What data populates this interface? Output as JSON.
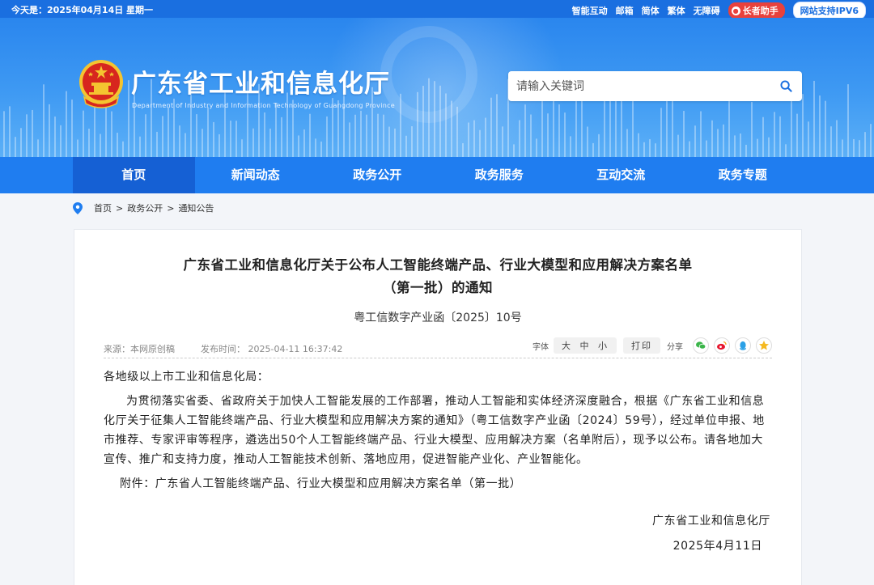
{
  "topbar": {
    "date": "今天是：2025年04月14日 星期一",
    "links": [
      "智能互动",
      "邮箱",
      "简体",
      "繁体",
      "无障碍"
    ],
    "elder_mode": "长者助手",
    "ipv6": "网站支持IPV6"
  },
  "header": {
    "site_title": "广东省工业和信息化厅",
    "site_subtitle": "Department of Industry and Information Technology of Guangdong Province",
    "emblem_icon": "national-emblem-icon",
    "search_placeholder": "请输入关键词"
  },
  "nav": {
    "items": [
      {
        "label": "首页",
        "active": true
      },
      {
        "label": "新闻动态",
        "active": false
      },
      {
        "label": "政务公开",
        "active": false
      },
      {
        "label": "政务服务",
        "active": false
      },
      {
        "label": "互动交流",
        "active": false
      },
      {
        "label": "政务专题",
        "active": false
      }
    ]
  },
  "breadcrumb": {
    "items": [
      "首页",
      "政务公开",
      "通知公告"
    ],
    "separator": ">"
  },
  "article": {
    "title": "广东省工业和信息化厅关于公布人工智能终端产品、行业大模型和应用解决方案名单（第一批）的通知",
    "doc_number": "粤工信数字产业函〔2025〕10号",
    "source": "来源：本网原创稿",
    "publish_time": "发布时间：  2025-04-11 16:37:42",
    "font_label": "字体",
    "font_sizes": [
      "大",
      "中",
      "小"
    ],
    "print_label": "打印",
    "share_label": "分享",
    "share_icons": [
      "wechat-icon",
      "weibo-icon",
      "qq-icon",
      "favorite-icon"
    ],
    "salutation": "各地级以上市工业和信息化局：",
    "paragraph": "为贯彻落实省委、省政府关于加快人工智能发展的工作部署，推动人工智能和实体经济深度融合，根据《广东省工业和信息化厅关于征集人工智能终端产品、行业大模型和应用解决方案的通知》（粤工信数字产业函〔2024〕59号），经过单位申报、地市推荐、专家评审等程序，遴选出50个人工智能终端产品、行业大模型、应用解决方案（名单附后），现予以公布。请各地加大宣传、推广和支持力度，推动人工智能技术创新、落地应用，促进智能产业化、产业智能化。",
    "attachment": "附件：广东省人工智能终端产品、行业大模型和应用解决方案名单（第一批）",
    "signature": "广东省工业和信息化厅",
    "sign_date": "2025年4月11日"
  },
  "colors": {
    "primary": "#1f7df0",
    "nav_active": "#1560d4",
    "elder_button": "#e8413c"
  }
}
